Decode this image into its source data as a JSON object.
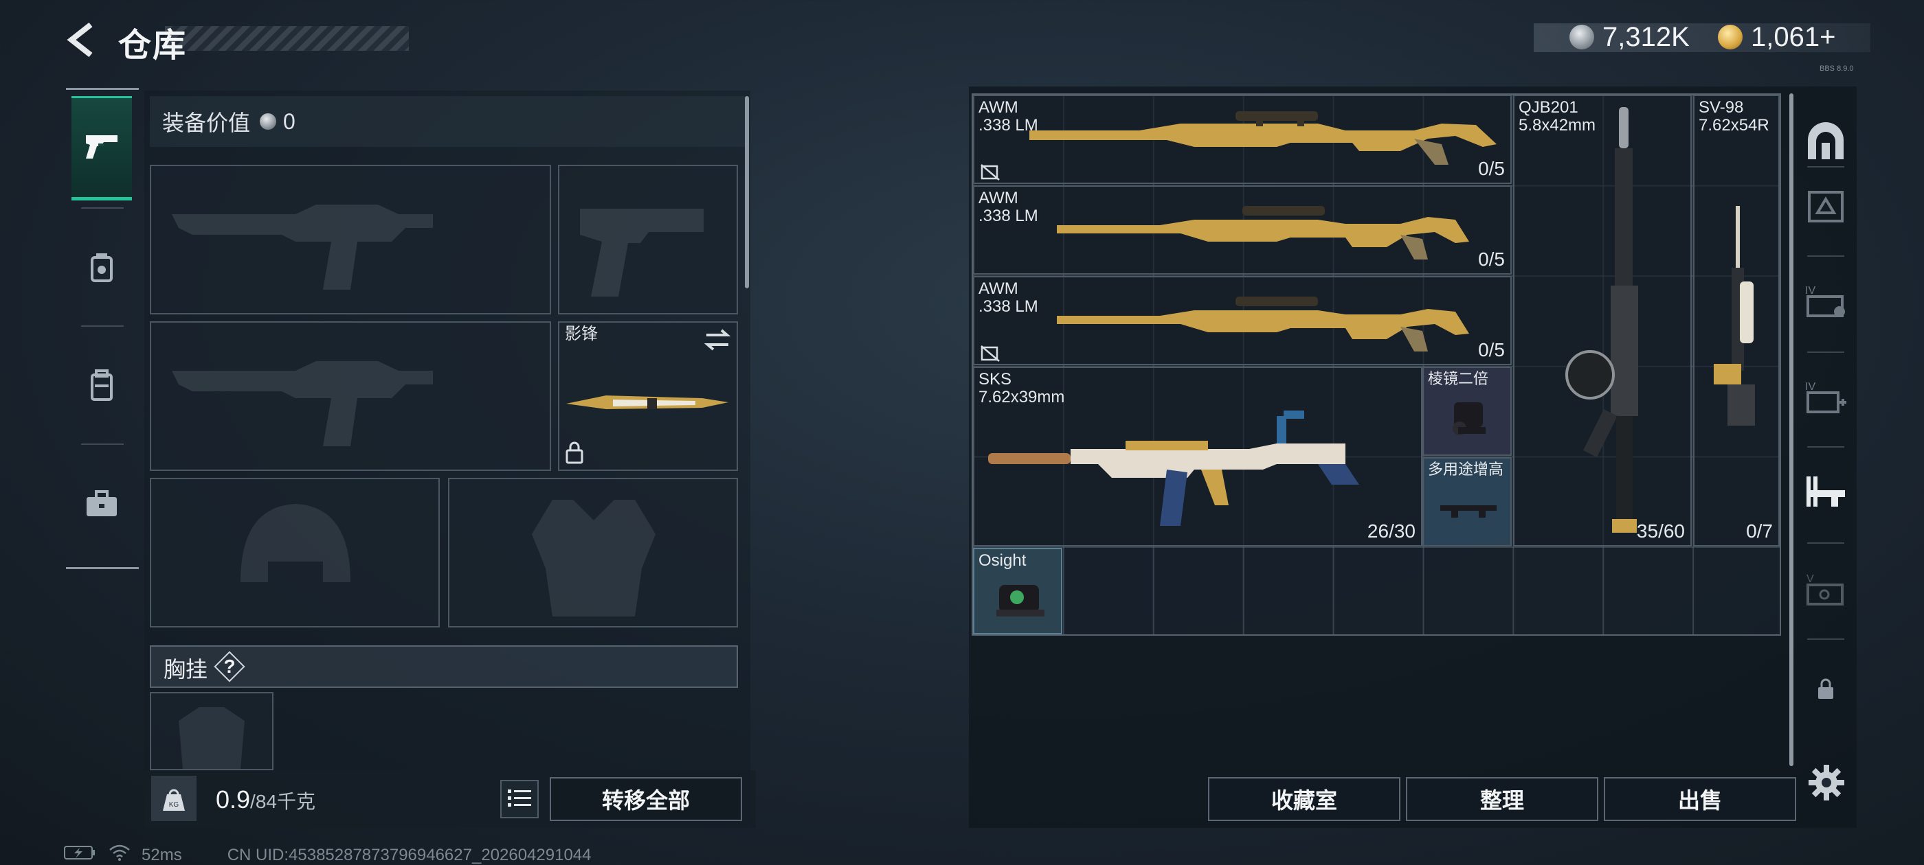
{
  "header": {
    "title": "仓库",
    "currency": {
      "silver": "7,312K",
      "gold": "1,061+"
    },
    "tiny_tag": "BBS 8.9.0"
  },
  "left_nav": {
    "items": [
      {
        "name": "weapons-tab",
        "icon": "pistol-icon",
        "active": true
      },
      {
        "name": "gear-tab",
        "icon": "armor-box-icon",
        "active": false
      },
      {
        "name": "backpack-tab",
        "icon": "backpack-icon",
        "active": false
      },
      {
        "name": "case-tab",
        "icon": "briefcase-icon",
        "active": false
      }
    ]
  },
  "equipment": {
    "value_label": "装备价值",
    "value": "0",
    "secondary_weapon": {
      "name": "影锋"
    },
    "chest_rig_label": "胸挂",
    "help": "?",
    "weight": "0.9",
    "weight_max": "/84千克",
    "transfer_all": "转移全部"
  },
  "stash": {
    "items": [
      {
        "name": "AWM",
        "caliber": ".338 LM",
        "count": "0/5"
      },
      {
        "name": "AWM",
        "caliber": ".338 LM",
        "count": "0/5"
      },
      {
        "name": "AWM",
        "caliber": ".338 LM",
        "count": "0/5"
      },
      {
        "name": "SKS",
        "caliber": "7.62x39mm",
        "count": "26/30"
      },
      {
        "name": "QJB201",
        "caliber": "5.8x42mm",
        "count": "35/60"
      },
      {
        "name": "SV-98",
        "caliber": "7.62x54R",
        "count": "0/7"
      },
      {
        "name": "棱镜二倍",
        "caliber": "",
        "count": ""
      },
      {
        "name": "多用途增高",
        "caliber": "",
        "count": ""
      },
      {
        "name": "Osight",
        "caliber": "",
        "count": ""
      }
    ],
    "buttons": {
      "collection": "收藏室",
      "organize": "整理",
      "sell": "出售"
    }
  },
  "right_nav": {
    "items": [
      "vault-icon",
      "container-icon",
      "level4-crate-icon",
      "level4-medical-icon",
      "weapon-rack-icon",
      "level5-crate-icon",
      "lock-icon"
    ]
  },
  "status_bar": {
    "ping": "52ms",
    "uid": "CN UID:453852878737969466​27_202604291044"
  },
  "colors": {
    "accent": "#27c49a",
    "panel": "#1a242e",
    "gold": "#c9a24a"
  }
}
